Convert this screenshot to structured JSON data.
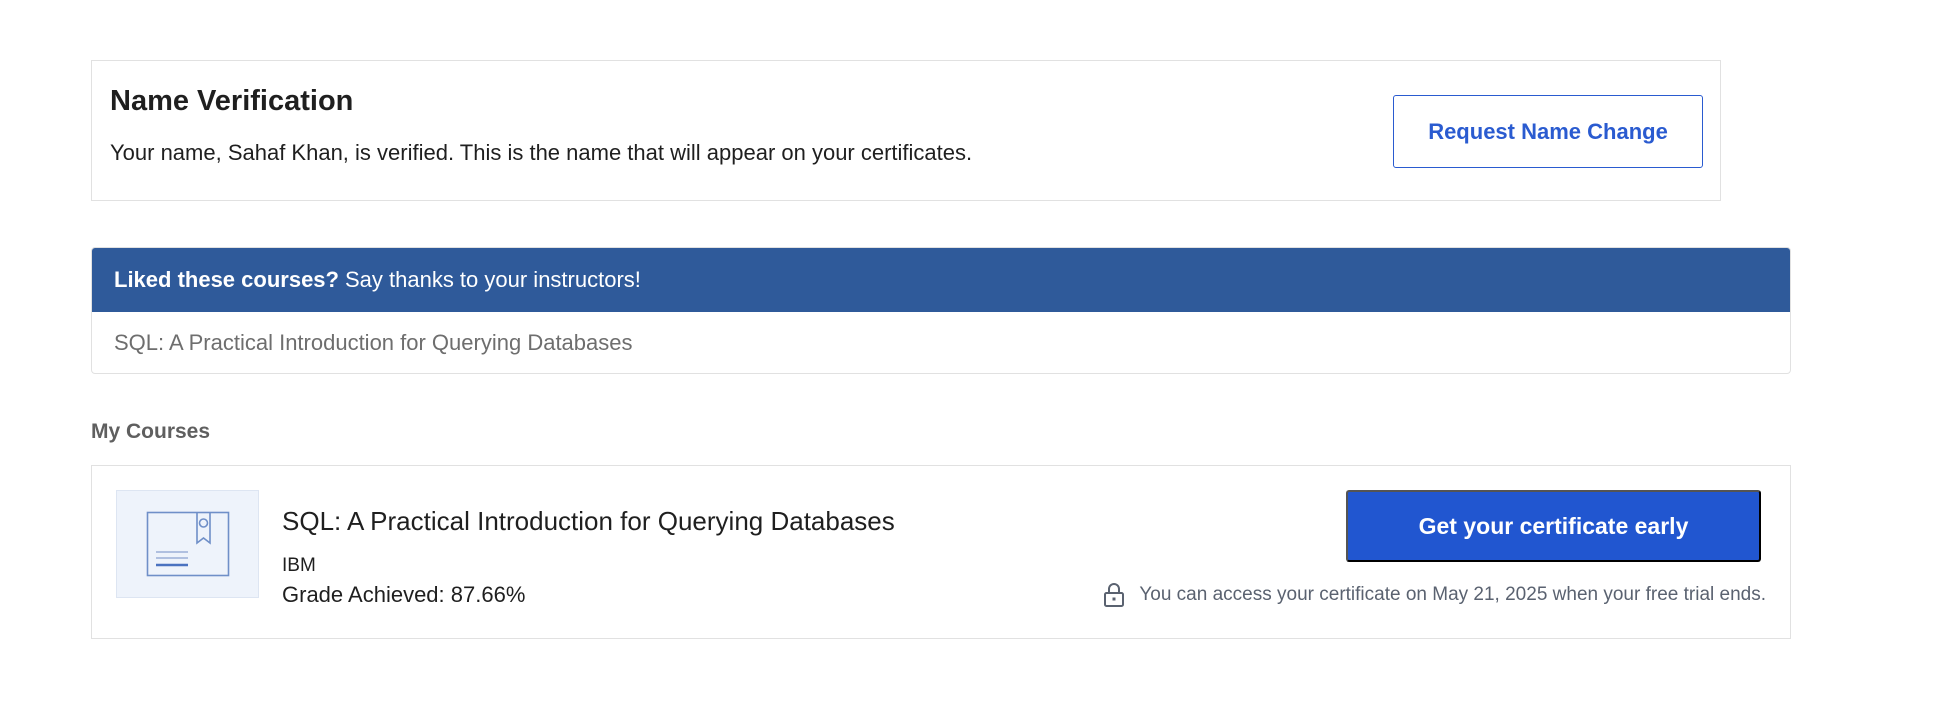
{
  "name_verification": {
    "title": "Name Verification",
    "description": "Your name, Sahaf Khan, is verified. This is the name that will appear on your certificates.",
    "button_label": "Request Name Change"
  },
  "thanks": {
    "header_bold": "Liked these courses?",
    "header_text": "Say thanks to your instructors!",
    "courses": [
      "SQL: A Practical Introduction for Querying Databases"
    ]
  },
  "my_courses": {
    "section_title": "My Courses",
    "items": [
      {
        "title": "SQL: A Practical Introduction for Querying Databases",
        "org": "IBM",
        "grade": "Grade Achieved: 87.66%",
        "cta_label": "Get your certificate early",
        "access_note": "You can access your certificate on May 21, 2025 when your free trial ends."
      }
    ]
  },
  "colors": {
    "brand_blue": "#2156d0",
    "header_blue": "#2f5a9a",
    "border": "#e1e1e1"
  },
  "icons": {
    "thumbnail": "certificate-icon",
    "lock": "lock-icon"
  }
}
